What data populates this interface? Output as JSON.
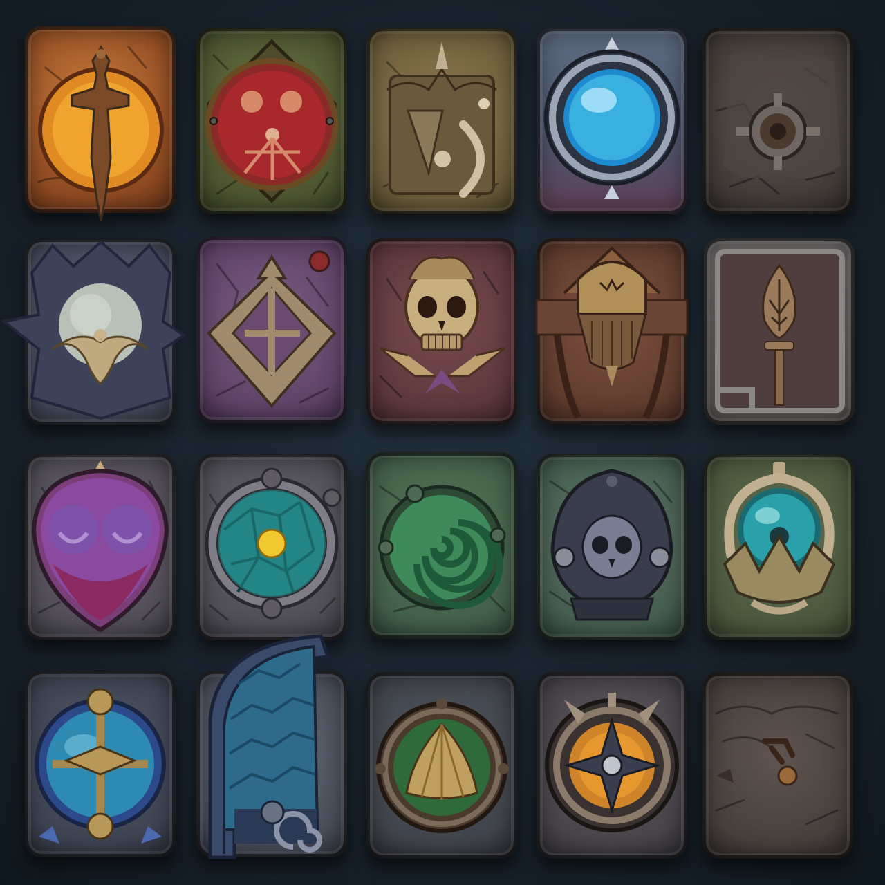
{
  "grid": {
    "rows": 4,
    "columns": 5
  },
  "colors": {
    "background": "#18222c",
    "stone_orange": "#a55a2c",
    "stone_olive": "#5e6a3c",
    "stone_khaki": "#7d6e48",
    "stone_slate_blue": "#4a5466",
    "stone_dark_grey": "#4b4440",
    "stone_violet": "#5f4c6c",
    "stone_plum": "#6a4860",
    "stone_rust_brown": "#6e4634",
    "stone_umber": "#5a463a",
    "stone_grey": "#5b5a62",
    "stone_green": "#4c6a48",
    "stone_sage": "#55705a",
    "stone_moss": "#556646",
    "accent_gold": "#b08850",
    "accent_cyan": "#3ab0e0",
    "accent_teal": "#2ab0b0",
    "accent_amber": "#f0b030",
    "accent_purple": "#8a4aa0",
    "accent_crimson": "#a8282c"
  },
  "tiles": [
    {
      "icon": "golden-dagger-icon"
    },
    {
      "icon": "crimson-orb-sigil-icon"
    },
    {
      "icon": "horn-and-blade-banner-icon"
    },
    {
      "icon": "blue-crystal-orb-icon"
    },
    {
      "icon": "stone-gear-door-icon"
    },
    {
      "icon": "frost-orb-crest-icon"
    },
    {
      "icon": "rune-arrow-icon"
    },
    {
      "icon": "bronze-skull-icon"
    },
    {
      "icon": "horned-helmet-totem-icon"
    },
    {
      "icon": "carved-spear-panel-icon"
    },
    {
      "icon": "purple-shield-icon"
    },
    {
      "icon": "stained-glass-porthole-icon"
    },
    {
      "icon": "green-spiral-icon"
    },
    {
      "icon": "iron-skull-plate-icon"
    },
    {
      "icon": "teal-orb-relic-icon"
    },
    {
      "icon": "azure-cross-orb-icon"
    },
    {
      "icon": "arched-stone-gate-icon"
    },
    {
      "icon": "golden-crystal-porthole-icon"
    },
    {
      "icon": "amber-star-compass-icon"
    },
    {
      "icon": "engraved-rune-slab-icon"
    }
  ]
}
